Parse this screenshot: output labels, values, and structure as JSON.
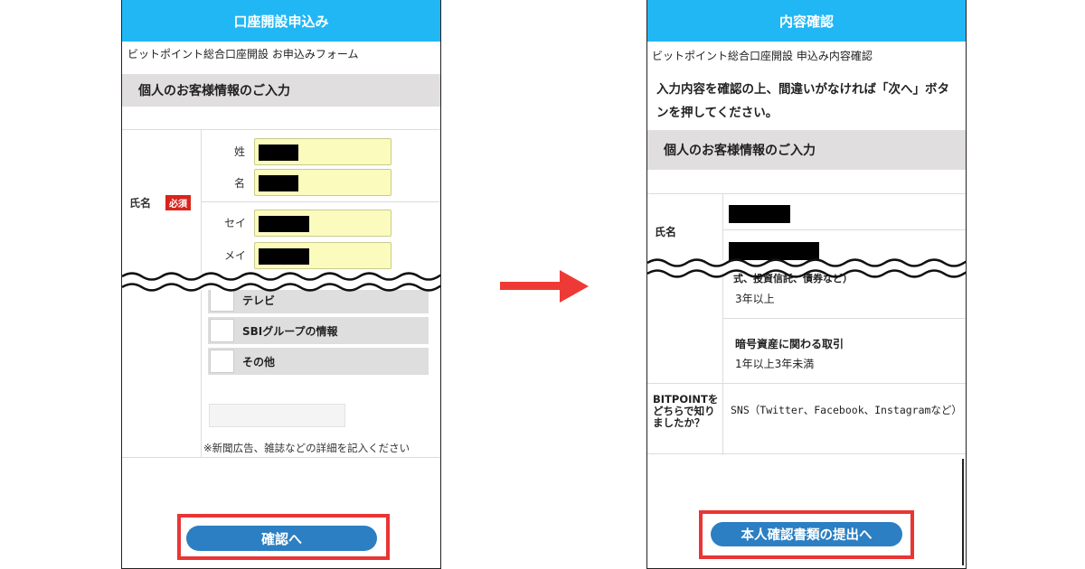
{
  "left_screen": {
    "header_title": "口座開設申込み",
    "form_name": "ビットポイント総合口座開設 お申込みフォーム",
    "section_title": "個人のお客様情報のご入力",
    "name_label": "氏名",
    "required_badge": "必須",
    "fields": [
      {
        "label": "姓"
      },
      {
        "label": "名"
      },
      {
        "label": "セイ"
      },
      {
        "label": "メイ"
      }
    ],
    "options": [
      {
        "label": "テレビ"
      },
      {
        "label": "SBIグループの情報"
      },
      {
        "label": "その他"
      }
    ],
    "note": "※新聞広告、雑誌などの詳細を記入ください",
    "confirm_button": "確認へ"
  },
  "right_screen": {
    "header_title": "内容確認",
    "form_name": "ビットポイント総合口座開設 申込み内容確認",
    "instruction": "入力内容を確認の上、間違いがなければ「次へ」ボタンを押してください。",
    "section_title": "個人のお客様情報のご入力",
    "name_label": "氏名",
    "partial_item_label": "式、投資信託、債券など）",
    "partial_item_value": "3年以上",
    "crypto_label": "暗号資産に関わる取引",
    "crypto_value": "1年以上3年未満",
    "source_label": "BITPOINTをどちらで知りましたか？",
    "source_value": "SNS（Twitter、Facebook、Instagramなど）",
    "submit_button": "本人確認書類の提出へ"
  },
  "colors": {
    "header_blue": "#21b7f5",
    "button_blue": "#2b7fc2",
    "highlight_red": "#ea3535",
    "required_red": "#d9241c",
    "input_yellow": "#fbfbbe",
    "section_gray": "#e1dee0"
  }
}
